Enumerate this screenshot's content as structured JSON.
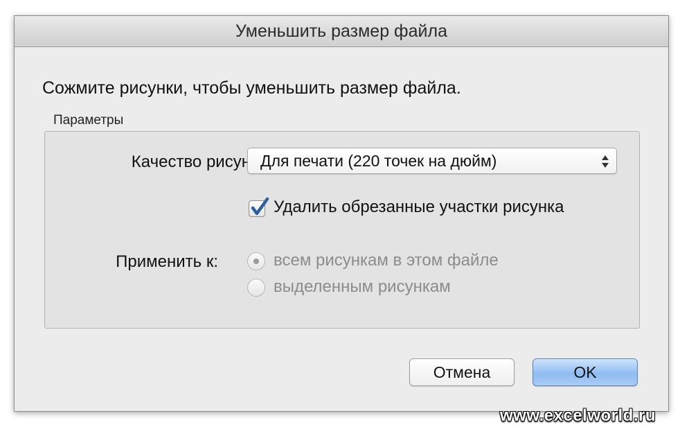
{
  "dialog": {
    "title": "Уменьшить размер файла",
    "intro": "Сожмите рисунки, чтобы уменьшить размер файла."
  },
  "options": {
    "group_label": "Параметры",
    "quality_label": "Качество рисунка:",
    "quality_value": "Для печати (220 точек на дюйм)",
    "delete_cropped": {
      "label": "Удалить обрезанные участки рисунка",
      "checked": true
    },
    "apply_label": "Применить к:",
    "apply_options": [
      {
        "label": "всем рисункам в этом файле",
        "selected": true,
        "enabled": false
      },
      {
        "label": "выделенным рисункам",
        "selected": false,
        "enabled": false
      }
    ]
  },
  "buttons": {
    "cancel": "Отмена",
    "ok": "OK"
  },
  "watermark": "www.excelworld.ru",
  "colors": {
    "accent_checkbox": "#2e5f9e",
    "ok_button": "#8fbcf0",
    "disabled_text": "#8c8c8c"
  }
}
